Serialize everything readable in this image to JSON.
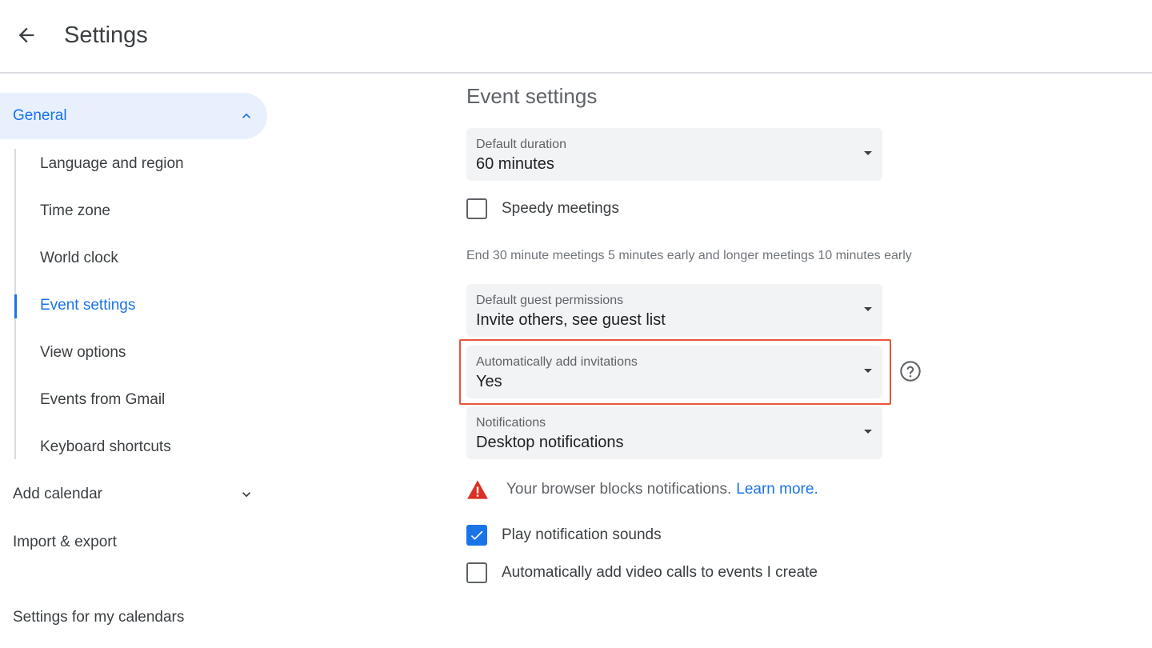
{
  "header": {
    "title": "Settings"
  },
  "sidebar": {
    "general": {
      "label": "General"
    },
    "general_items": [
      {
        "label": "Language and region",
        "active": false
      },
      {
        "label": "Time zone",
        "active": false
      },
      {
        "label": "World clock",
        "active": false
      },
      {
        "label": "Event settings",
        "active": true
      },
      {
        "label": "View options",
        "active": false
      },
      {
        "label": "Events from Gmail",
        "active": false
      },
      {
        "label": "Keyboard shortcuts",
        "active": false
      }
    ],
    "add_calendar": {
      "label": "Add calendar"
    },
    "import_export": {
      "label": "Import & export"
    },
    "my_calendars_heading": "Settings for my calendars"
  },
  "main": {
    "section_title": "Event settings",
    "default_duration": {
      "label": "Default duration",
      "value": "60 minutes"
    },
    "speedy_meetings": {
      "label": "Speedy meetings",
      "checked": false
    },
    "speedy_helper": "End 30 minute meetings 5 minutes early and longer meetings 10 minutes early",
    "guest_permissions": {
      "label": "Default guest permissions",
      "value": "Invite others, see guest list"
    },
    "auto_add_invitations": {
      "label": "Automatically add invitations",
      "value": "Yes"
    },
    "notifications": {
      "label": "Notifications",
      "value": "Desktop notifications"
    },
    "warning": {
      "text": "Your browser blocks notifications.",
      "link": "Learn more."
    },
    "play_sounds": {
      "label": "Play notification sounds",
      "checked": true
    },
    "auto_video_calls": {
      "label": "Automatically add video calls to events I create",
      "checked": false
    }
  },
  "colors": {
    "accent": "#1a73e8",
    "highlight": "#e8553a",
    "warning": "#d93025",
    "nav_active_bg": "#e8f0fe",
    "field_bg": "#f1f3f4"
  },
  "icons": {
    "back": "arrow-left-icon",
    "collapse": "chevron-up-icon",
    "expand": "chevron-down-icon",
    "dropdown": "caret-down-icon",
    "help": "help-circle-icon",
    "warning": "warning-triangle-icon",
    "check": "check-icon"
  }
}
